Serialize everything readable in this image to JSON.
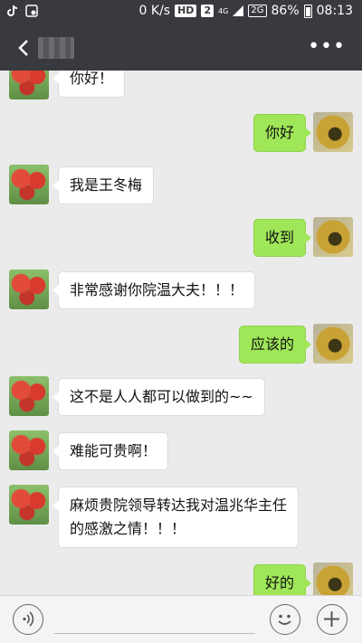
{
  "status_bar": {
    "tiktok_icon": "tiktok-icon",
    "image_icon": "image-icon",
    "network_speed": "0 K/s",
    "hd_badge": "HD",
    "sim_badge": "2",
    "network_4g": "4G",
    "network_2g": "2G",
    "battery_percent": "86%",
    "time": "08:13"
  },
  "title_bar": {
    "back_icon": "back-arrow-icon",
    "more_icon": "more-icon",
    "more_label": "•••"
  },
  "messages": [
    {
      "side": "left",
      "text": "你好！"
    },
    {
      "side": "right",
      "text": "你好"
    },
    {
      "side": "left",
      "text": "我是王冬梅"
    },
    {
      "side": "right",
      "text": "收到"
    },
    {
      "side": "left",
      "text": "非常感谢你院温大夫！！！"
    },
    {
      "side": "right",
      "text": "应该的"
    },
    {
      "side": "left",
      "text": "这不是人人都可以做到的~~"
    },
    {
      "side": "left",
      "text": "难能可贵啊！"
    },
    {
      "side": "left",
      "text": "麻烦贵院领导转达我对温兆华主任\n的感激之情！！！"
    },
    {
      "side": "right",
      "text": "好的"
    }
  ],
  "input_bar": {
    "voice_icon": "voice-icon",
    "input_value": "",
    "emoji_icon": "emoji-icon",
    "plus_icon": "plus-icon"
  },
  "colors": {
    "header_bg": "#393a3f",
    "chat_bg": "#ebebeb",
    "sent_bubble": "#9fe658",
    "received_bubble": "#ffffff"
  }
}
